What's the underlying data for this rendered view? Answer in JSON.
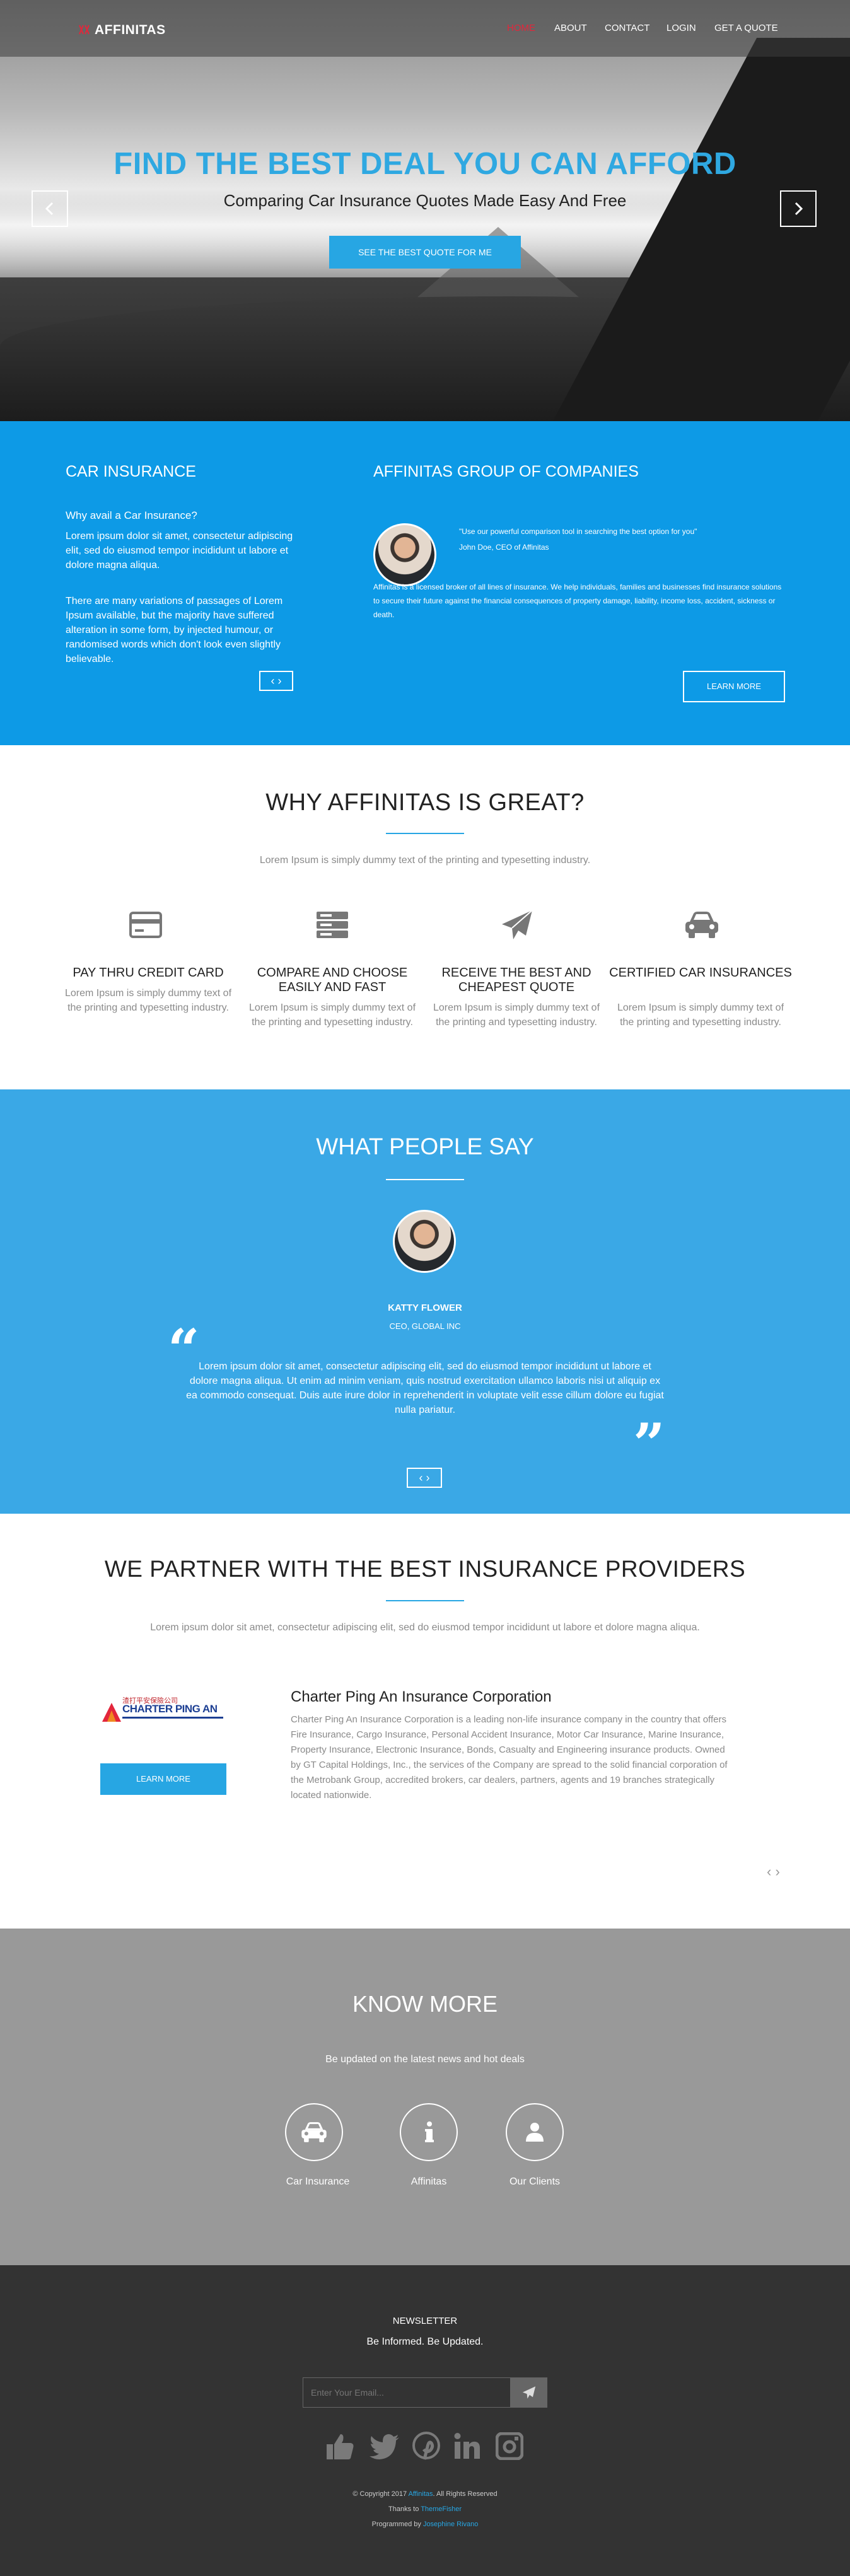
{
  "brand": {
    "name": "AFFINITAS",
    "accent": "#e3263b",
    "blue": "#0d9ae6"
  },
  "nav": {
    "items": [
      "HOME",
      "ABOUT",
      "CONTACT",
      "LOGIN",
      "GET A QUOTE"
    ],
    "active": "HOME"
  },
  "hero": {
    "title": "FIND THE BEST DEAL YOU CAN AFFORD",
    "subtitle": "Comparing Car Insurance Quotes Made Easy And Free",
    "cta": "SEE THE BEST QUOTE FOR ME",
    "prev_icon": "chevron-left-icon",
    "next_icon": "chevron-right-icon"
  },
  "info": {
    "left": {
      "title": "CAR INSURANCE",
      "question": "Why avail a Car Insurance?",
      "para1": "Lorem ipsum dolor sit amet, consectetur adipiscing elit, sed do eiusmod tempor incididunt ut labore et dolore magna aliqua.",
      "para2": "There are many variations of passages of Lorem Ipsum available, but the majority have suffered alteration in some form, by injected humour, or randomised words which don't look even slightly believable.",
      "pager": "‹ ›"
    },
    "right": {
      "title": "AFFINITAS GROUP OF COMPANIES",
      "quote": "\"Use our powerful comparison tool in searching the best option for you\"",
      "author": "John Doe, CEO of Affinitas",
      "body": "Affinitas is a licensed broker of all lines of insurance. We help individuals, families and businesses find insurance solutions to secure their future against the financial consequences of property damage, liability, income loss, accident, sickness or death.",
      "button": "LEARN MORE"
    }
  },
  "why": {
    "title": "WHY AFFINITAS IS GREAT?",
    "intro": "Lorem Ipsum is simply dummy text of the printing and typesetting industry.",
    "features": [
      {
        "icon": "credit-card-icon",
        "title": "PAY THRU CREDIT CARD",
        "text": "Lorem Ipsum is simply dummy text of the printing and typesetting industry."
      },
      {
        "icon": "server-icon",
        "title": "COMPARE AND CHOOSE EASILY AND FAST",
        "text": "Lorem Ipsum is simply dummy text of the printing and typesetting industry."
      },
      {
        "icon": "paper-plane-icon",
        "title": "RECEIVE THE BEST AND CHEAPEST QUOTE",
        "text": "Lorem Ipsum is simply dummy text of the printing and typesetting industry."
      },
      {
        "icon": "car-icon",
        "title": "CERTIFIED CAR INSURANCES",
        "text": "Lorem Ipsum is simply dummy text of the printing and typesetting industry."
      }
    ]
  },
  "testimonial": {
    "title": "WHAT PEOPLE SAY",
    "name": "KATTY FLOWER",
    "role": "CEO, GLOBAL INC",
    "text": "Lorem ipsum dolor sit amet, consectetur adipiscing elit, sed do eiusmod tempor incididunt ut labore et dolore magna aliqua. Ut enim ad minim veniam, quis nostrud exercitation ullamco laboris nisi ut aliquip ex ea commodo consequat. Duis aute irure dolor in reprehenderit in voluptate velit esse cillum dolore eu fugiat nulla pariatur.",
    "open_quote": "“",
    "close_quote": "”",
    "pager": "‹ ›"
  },
  "partners": {
    "title": "WE PARTNER WITH THE BEST INSURANCE PROVIDERS",
    "intro": "Lorem ipsum dolor sit amet, consectetur adipiscing elit, sed do eiusmod tempor incididunt ut labore et dolore magna aliqua.",
    "logo_text": "CHARTER PING AN",
    "logo_cn": "渣打平安保險公司",
    "name": "Charter Ping An Insurance Corporation",
    "description": "Charter Ping An Insurance Corporation is a leading non-life insurance company in the country that offers Fire Insurance, Cargo Insurance, Personal Accident Insurance, Motor Car Insurance, Marine Insurance, Property Insurance, Electronic Insurance, Bonds, Casualty and Engineering insurance products. Owned by GT Capital Holdings, Inc., the services of the Company are spread to the solid financial corporation of the Metrobank Group, accredited brokers, car dealers, partners, agents and 19 branches strategically located nationwide.",
    "button": "LEARN MORE",
    "pager": "‹ ›"
  },
  "know_more": {
    "title": "KNOW MORE",
    "subtitle": "Be updated on the latest news and hot deals",
    "items": [
      {
        "icon": "car-icon",
        "label": "Car Insurance"
      },
      {
        "icon": "info-icon",
        "label": "Affinitas"
      },
      {
        "icon": "user-icon",
        "label": "Our Clients"
      }
    ]
  },
  "footer": {
    "newsletter": "NEWSLETTER",
    "tagline": "Be Informed. Be Updated.",
    "email_placeholder": "Enter Your Email...",
    "socials": [
      "thumbs-up-icon",
      "twitter-icon",
      "pinterest-icon",
      "linkedin-icon",
      "instagram-icon"
    ],
    "copyright_pre": "© Copyright 2017",
    "copyright_link": "Affinitas",
    "copyright_post": ". All Rights Reserved",
    "thanks_pre": "Thanks to",
    "thanks_link": "ThemeFisher",
    "prog_pre": "Programmed by",
    "prog_link": "Josephine Rivano"
  }
}
